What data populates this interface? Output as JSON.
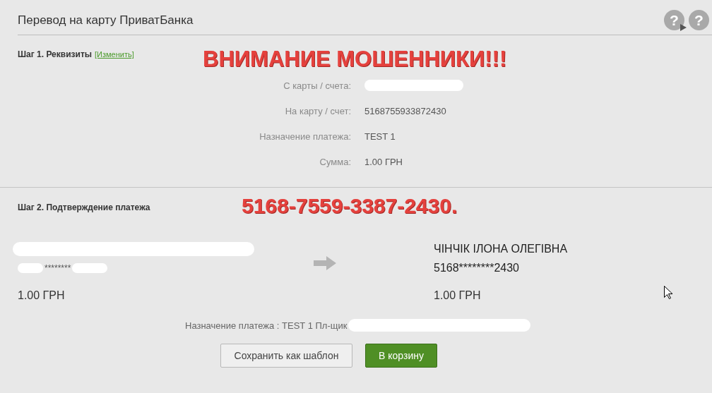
{
  "header": {
    "title": "Перевод на карту ПриватБанка",
    "help_buttons": [
      {
        "label": "?",
        "kind": "video"
      },
      {
        "label": "?",
        "kind": "plain"
      }
    ]
  },
  "warnings": [
    {
      "text": "ВНИМАНИЕ МОШЕННИКИ!!!"
    },
    {
      "text": "5168-7559-3387-2430."
    }
  ],
  "step1": {
    "heading": "Шаг 1. Реквизиты",
    "edit_link": "[Изменить]",
    "rows": [
      {
        "label": "С карты / счета:",
        "redacted": true
      },
      {
        "label": "На карту / счет:",
        "value": "5168755933872430",
        "redacted": false
      },
      {
        "label": "Назначение платежа:",
        "value": "TEST 1",
        "redacted": false
      },
      {
        "label": "Сумма:",
        "value": "1.00 ГРН",
        "redacted": false
      }
    ]
  },
  "step2": {
    "heading": "Шаг 2. Подтверждение платежа",
    "sender": {
      "name": {
        "redacted": true
      },
      "card": {
        "text": "********",
        "redacted": true
      },
      "amount": "1.00 ГРН"
    },
    "recipient": {
      "name": "ЧІНЧІК ІЛОНА ОЛЕГІВНА",
      "card": "5168********2430",
      "amount": "1.00 ГРН"
    },
    "purpose": {
      "text": "Назначение платежа : TEST 1 Пл-щик",
      "redacted": true
    },
    "buttons": [
      {
        "label": "Сохранить как шаблон",
        "kind": "secondary"
      },
      {
        "label": "В корзину",
        "kind": "primary"
      }
    ]
  }
}
